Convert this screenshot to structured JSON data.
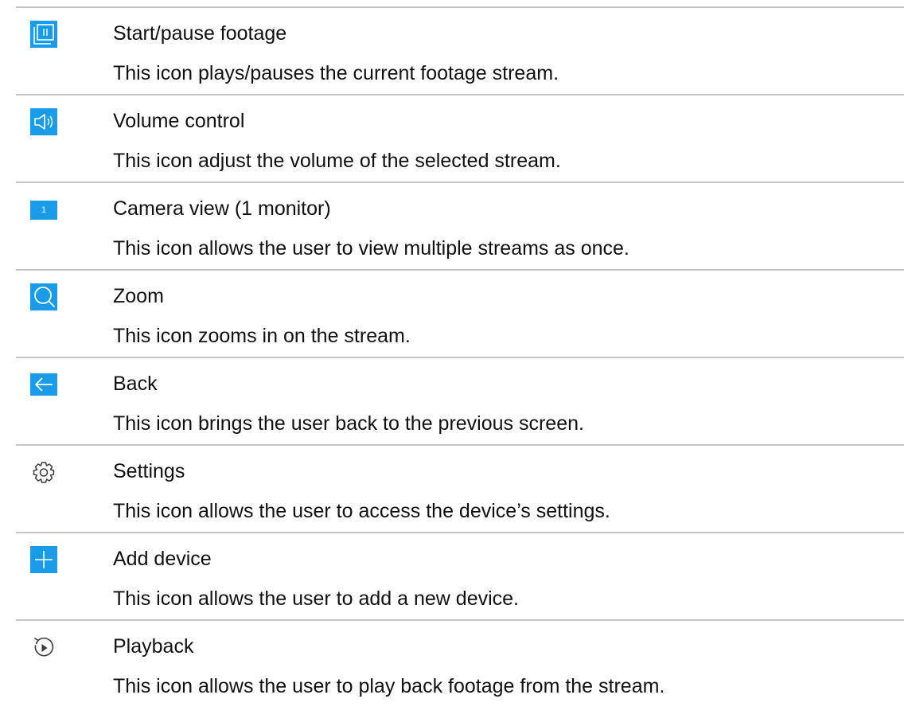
{
  "accent_color": "#1a9be8",
  "divider_color": "#c6c6c6",
  "rows": [
    {
      "icon": "pause-icon",
      "title": "Start/pause footage",
      "description": "This icon plays/pauses the current footage stream."
    },
    {
      "icon": "volume-icon",
      "title": "Volume control",
      "description": "This icon adjust the volume of the selected stream."
    },
    {
      "icon": "single-camera-view-icon",
      "icon_text": "1",
      "title": "Camera view (1 monitor)",
      "description": "This icon allows the user to view multiple streams as once."
    },
    {
      "icon": "zoom-icon",
      "title": "Zoom",
      "description": "This icon zooms in on the stream."
    },
    {
      "icon": "back-arrow-icon",
      "title": "Back",
      "description": "This icon brings the user back to the previous screen."
    },
    {
      "icon": "gear-icon",
      "title": "Settings",
      "description": "This icon allows the user to access the device’s settings."
    },
    {
      "icon": "plus-icon",
      "title": "Add device",
      "description": "This icon allows the user to add a new device."
    },
    {
      "icon": "playback-icon",
      "title": "Playback",
      "description": "This icon allows the user to play back footage from the stream."
    }
  ]
}
